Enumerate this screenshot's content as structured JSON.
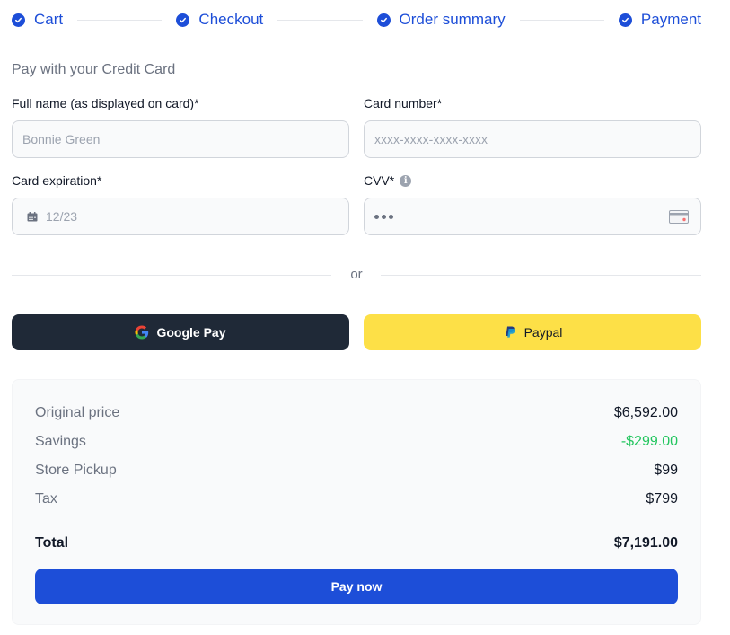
{
  "stepper": {
    "steps": [
      {
        "label": "Cart"
      },
      {
        "label": "Checkout"
      },
      {
        "label": "Order summary"
      },
      {
        "label": "Payment"
      }
    ]
  },
  "form": {
    "title": "Pay with your Credit Card",
    "full_name": {
      "label": "Full name (as displayed on card)*",
      "placeholder": "Bonnie Green",
      "value": ""
    },
    "card_number": {
      "label": "Card number*",
      "placeholder": "xxxx-xxxx-xxxx-xxxx",
      "value": ""
    },
    "expiration": {
      "label": "Card expiration*",
      "placeholder": "12/23",
      "value": ""
    },
    "cvv": {
      "label": "CVV*",
      "placeholder": "•••",
      "value": ""
    },
    "divider_text": "or"
  },
  "payment_buttons": {
    "google_pay": "Google Pay",
    "paypal": "Paypal"
  },
  "summary": {
    "rows": [
      {
        "label": "Original price",
        "value": "$6,592.00"
      },
      {
        "label": "Savings",
        "value": "-$299.00"
      },
      {
        "label": "Store Pickup",
        "value": "$99"
      },
      {
        "label": "Tax",
        "value": "$799"
      }
    ],
    "total": {
      "label": "Total",
      "value": "$7,191.00"
    },
    "pay_now": "Pay now"
  },
  "colors": {
    "accent": "#1d4ed8",
    "dark_button": "#1f2937",
    "paypal_button": "#fde047",
    "savings": "#22c55e"
  },
  "icons": {
    "step": "check-circle-icon",
    "info": "info-icon",
    "calendar": "calendar-icon",
    "card": "credit-card-icon",
    "google": "google-icon",
    "paypal": "paypal-icon"
  }
}
